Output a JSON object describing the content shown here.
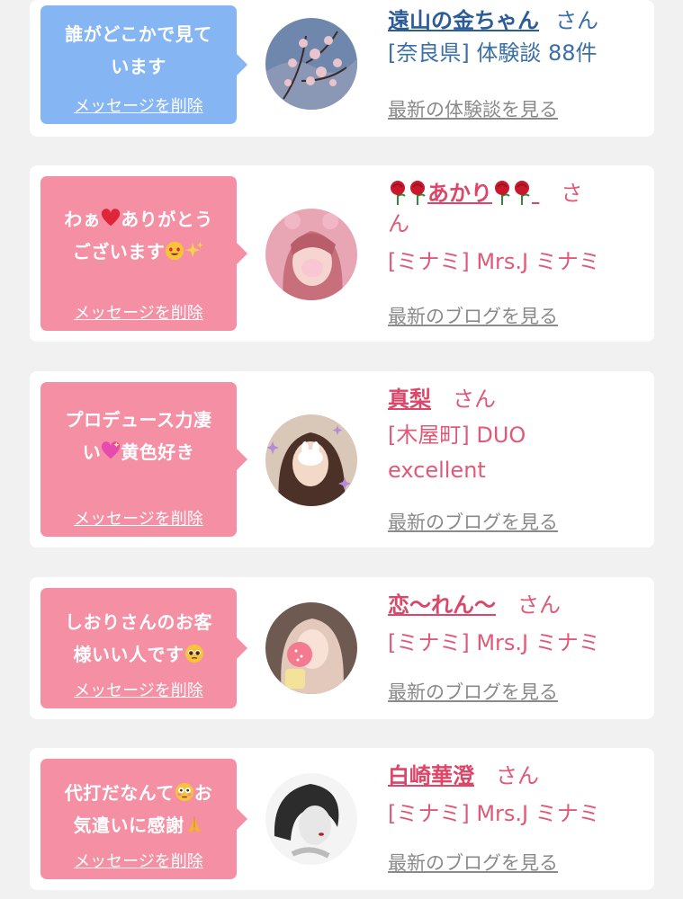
{
  "cards": [
    {
      "message": "誰がどこかで見ています",
      "message_lines": [
        "誰がどこかで見て",
        "います"
      ],
      "delete_label": "メッセージを削除",
      "name": "遠山の金ちゃん",
      "honorific": "さん",
      "shop": "[奈良県] 体験談 88件",
      "latest_link": "最新の体験談を見る",
      "theme": "blue"
    },
    {
      "message_lines": [
        "わぁ",
        "ありがとう",
        "ございます"
      ],
      "delete_label": "メッセージを削除",
      "name": "あかり",
      "honorific_a": "さ",
      "honorific_b": "ん",
      "shop": "[ミナミ] Mrs.J ミナミ",
      "latest_link": "最新のブログを見る",
      "theme": "pink"
    },
    {
      "message_lines": [
        "プロデュース力凄",
        "い",
        "黄色好き"
      ],
      "delete_label": "メッセージを削除",
      "name": "真梨",
      "honorific": "さん",
      "shop_line1": "[木屋町] DUO",
      "shop_line2": "excellent",
      "latest_link": "最新のブログを見る",
      "theme": "pink"
    },
    {
      "message_lines": [
        "しおりさんのお客",
        "様いい人です"
      ],
      "delete_label": "メッセージを削除",
      "name": "恋〜れん〜",
      "honorific": "さん",
      "shop": "[ミナミ] Mrs.J ミナミ",
      "latest_link": "最新のブログを見る",
      "theme": "pink"
    },
    {
      "message_lines": [
        "代打だなんて",
        "お",
        "気遣いに感謝"
      ],
      "delete_label": "メッセージを削除",
      "name": "白崎華澄",
      "honorific": "さん",
      "shop": "[ミナミ] Mrs.J ミナミ",
      "latest_link": "最新のブログを見る",
      "theme": "pink"
    }
  ],
  "colors": {
    "bubble_blue": "#86b5f4",
    "bubble_pink": "#f48fa4",
    "name_blue": "#2b5c98",
    "name_pink": "#dc4668",
    "page_bg": "#f1f1f1"
  }
}
